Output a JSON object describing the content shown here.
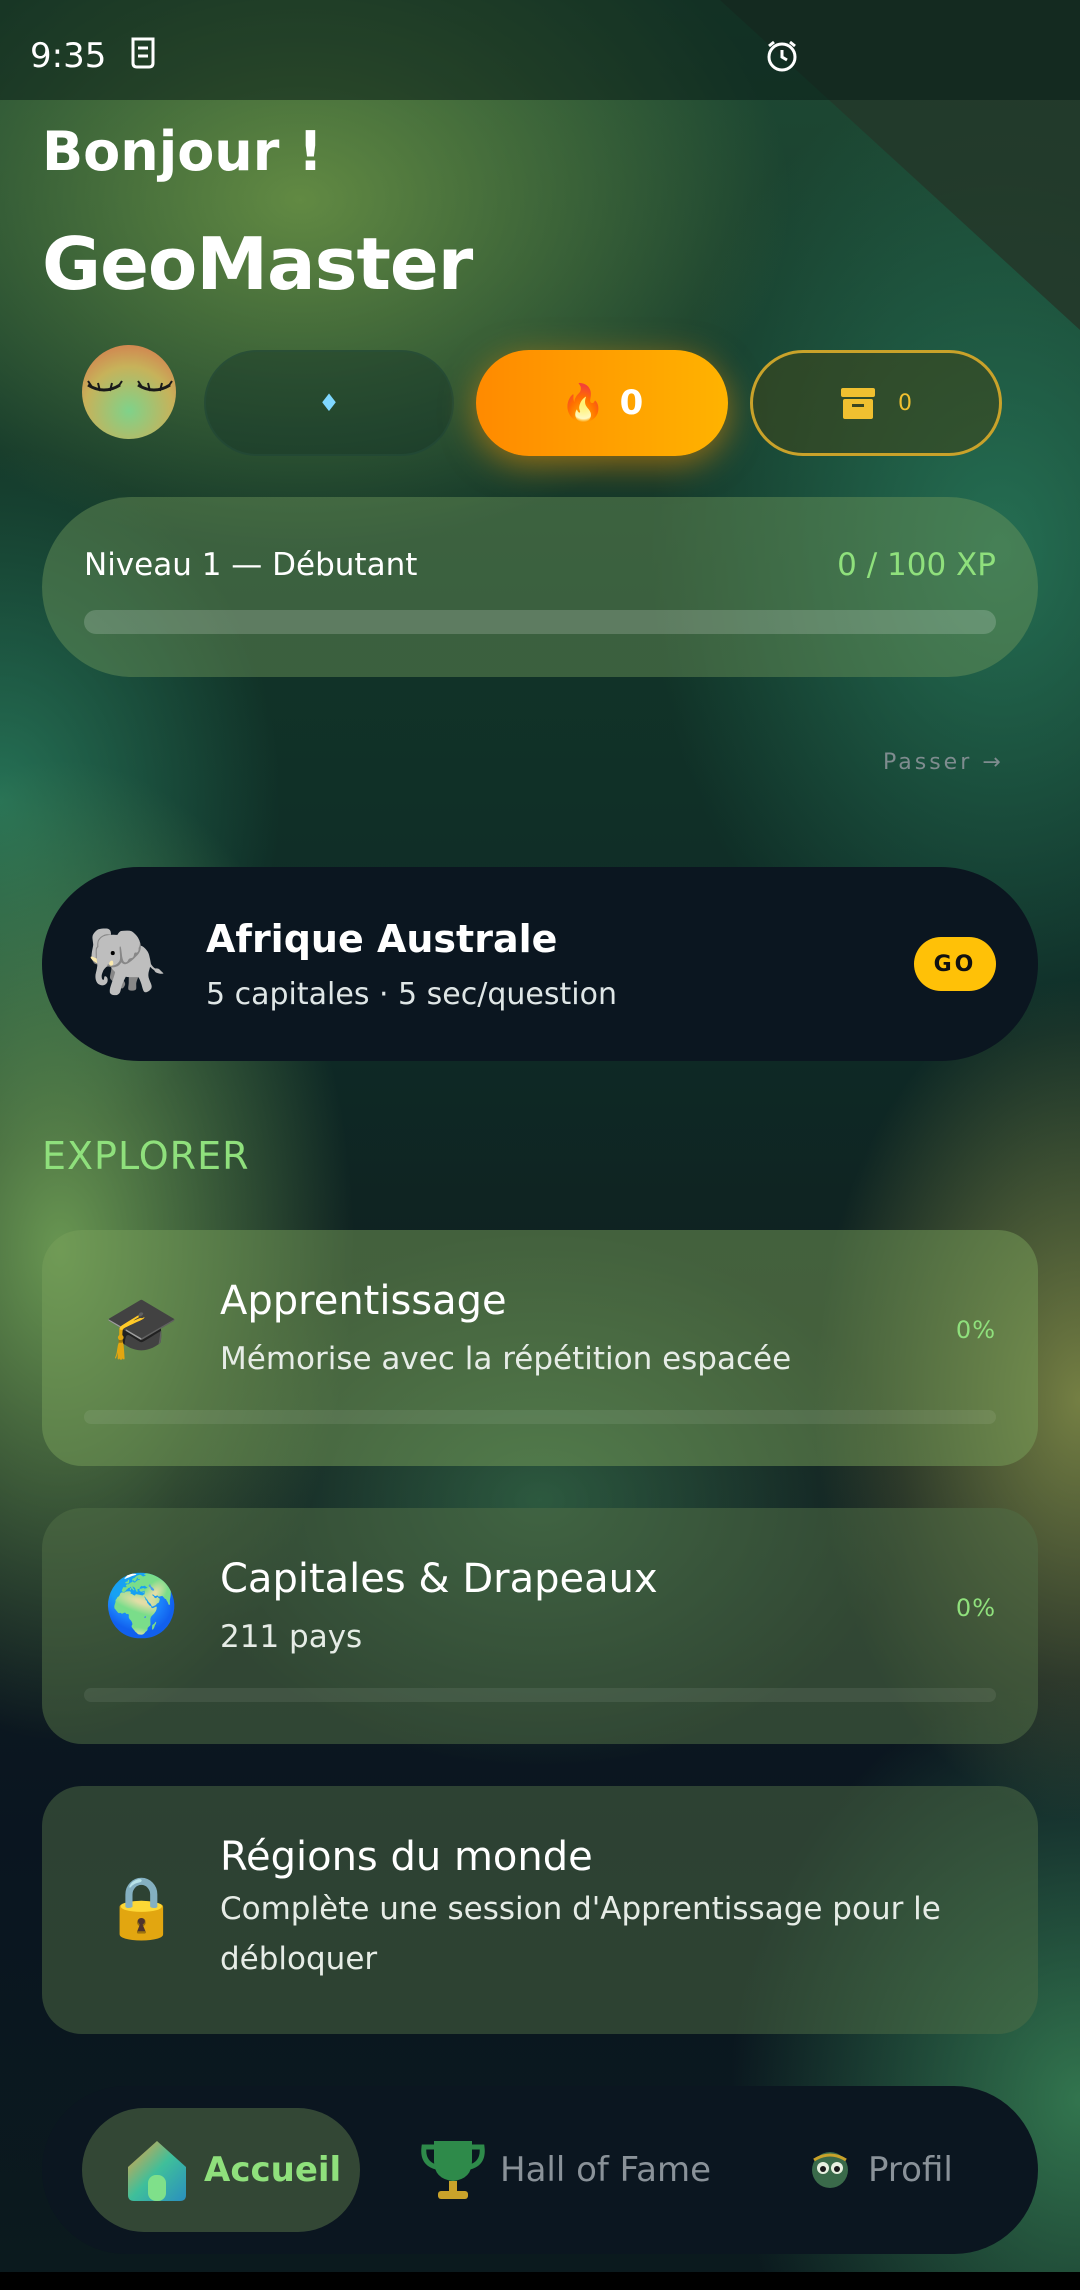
{
  "status_bar": {
    "time": "9:35"
  },
  "header": {
    "greeting": "Bonjour !",
    "username": "GeoMaster"
  },
  "stats": {
    "gems_value": "",
    "streak_value": "0",
    "chest_value": "0"
  },
  "level": {
    "label": "Niveau 1 — Débutant",
    "xp_text": "0 / 100 XP",
    "progress": 0
  },
  "skip_label": "Passer →",
  "daily_challenge": {
    "icon": "elephant-icon",
    "title": "Afrique Australe",
    "subtitle": "5 capitales · 5 sec/question",
    "go_label": "GO"
  },
  "explore": {
    "section_title": "EXPLORER",
    "modes": [
      {
        "icon": "graduation-cap-icon",
        "title": "Apprentissage",
        "subtitle": "Mémorise avec la répétition espacée",
        "percent": "0%",
        "progress": 0
      },
      {
        "icon": "globe-icon",
        "title": "Capitales & Drapeaux",
        "subtitle": "211 pays",
        "percent": "0%",
        "progress": 0
      },
      {
        "icon": "lock-icon",
        "title": "Régions du monde",
        "subtitle": "Complète une session d'Apprentissage pour le débloquer"
      }
    ]
  },
  "nav": {
    "items": [
      {
        "label": "Accueil",
        "icon": "home-icon",
        "active": true
      },
      {
        "label": "Hall of Fame",
        "icon": "trophy-icon",
        "active": false
      },
      {
        "label": "Profil",
        "icon": "profile-icon",
        "active": false
      }
    ]
  },
  "colors": {
    "accent_green": "#8fe07c",
    "streak_orange": "#ff9800",
    "go_yellow": "#ffc107",
    "card_dark": "#0b1620"
  }
}
